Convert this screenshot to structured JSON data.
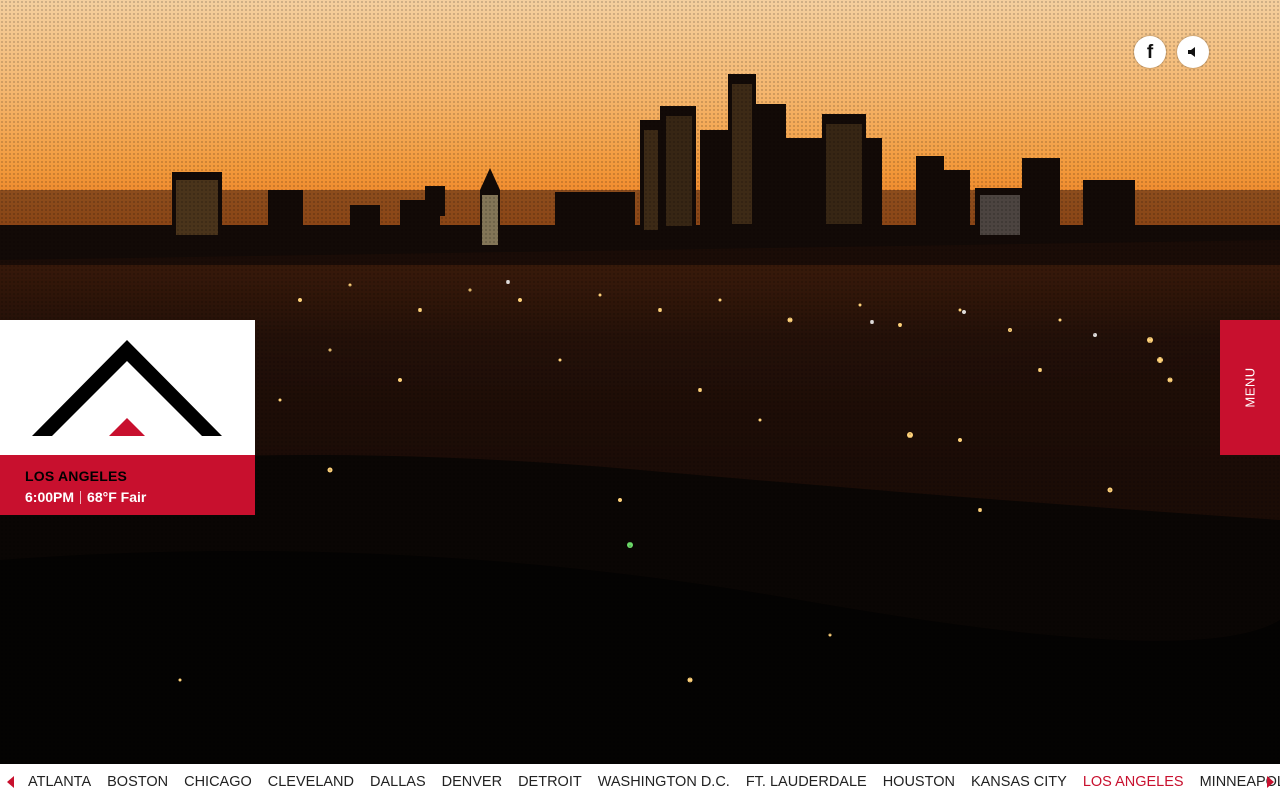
{
  "colors": {
    "brand_red": "#c8102e",
    "sky_top": "#f2c08a",
    "sky_mid": "#f07a1a",
    "city_dark": "#0b0604"
  },
  "social": {
    "facebook_icon": "facebook-icon",
    "facebook_glyph": "f",
    "sound_icon": "speaker-icon"
  },
  "logo_card": {
    "logo_icon": "roof-chevron-logo",
    "city_name": "LOS ANGELES",
    "time": "6:00PM",
    "weather": "68°F Fair"
  },
  "menu": {
    "label": "MENU"
  },
  "city_bar": {
    "prev_icon": "arrow-left-icon",
    "next_icon": "arrow-right-icon",
    "cities": [
      {
        "label": "ATLANTA"
      },
      {
        "label": "BOSTON"
      },
      {
        "label": "CHICAGO"
      },
      {
        "label": "CLEVELAND"
      },
      {
        "label": "DALLAS"
      },
      {
        "label": "DENVER"
      },
      {
        "label": "DETROIT"
      },
      {
        "label": "WASHINGTON D.C."
      },
      {
        "label": "FT. LAUDERDALE"
      },
      {
        "label": "HOUSTON"
      },
      {
        "label": "KANSAS CITY"
      },
      {
        "label": "LOS ANGELES"
      },
      {
        "label": "MINNEAPOLIS"
      }
    ],
    "active_city": "LOS ANGELES"
  }
}
